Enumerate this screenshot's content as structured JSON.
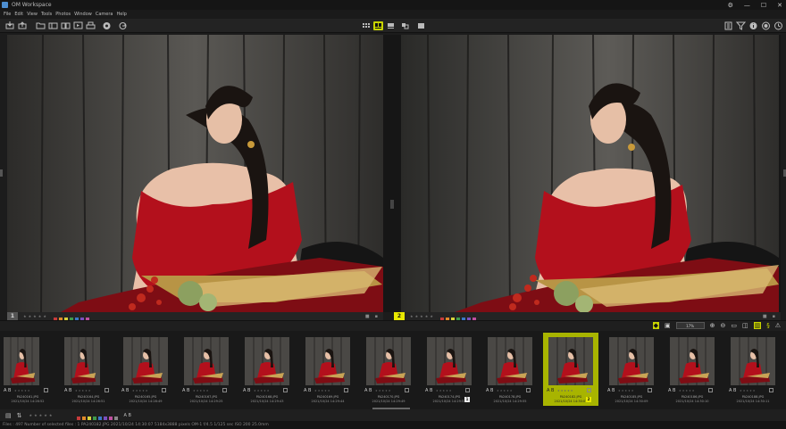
{
  "app": {
    "title": "OM Workspace"
  },
  "window_controls": [
    "⚙",
    "—",
    "☐",
    "✕"
  ],
  "menu": [
    "File",
    "Edit",
    "View",
    "Tools",
    "Photos",
    "Window",
    "Camera",
    "Help"
  ],
  "toolbar_left_icons": [
    "import-icon",
    "export-icon",
    "folder-icon",
    "layout-icon",
    "compare-icon",
    "slideshow-icon",
    "print-icon",
    "share-icon",
    "camera-icon",
    "record-icon",
    "sync-icon"
  ],
  "toolbar_center_icons": [
    "grid-view-icon",
    "compare-view-icon",
    "list-view-icon",
    "single-view-icon"
  ],
  "toolbar_right_icons": [
    "panel-icon",
    "filter-icon",
    "info-icon",
    "raw-icon",
    "history-icon"
  ],
  "panes": [
    {
      "number": "1",
      "active": false
    },
    {
      "number": "2",
      "active": true
    }
  ],
  "rating_stars": "★★★★★",
  "color_labels": [
    "#c63b3b",
    "#e08a2a",
    "#d8d23b",
    "#3f9a4a",
    "#3a78c8",
    "#7b4fc0",
    "#c050a0",
    "#888888"
  ],
  "zoom": {
    "value": "17%"
  },
  "thumbnails": [
    {
      "ab": "A B",
      "name": "PA240161.JPG",
      "date": "2021/10/24 14:26:52",
      "selected": false,
      "portrait": true,
      "badge": ""
    },
    {
      "ab": "A B",
      "name": "PA240164.JPG",
      "date": "2021/10/24 14:26:51",
      "selected": false,
      "portrait": true,
      "badge": ""
    },
    {
      "ab": "A B",
      "name": "PA240165.JPG",
      "date": "2021/10/24 14:28:49",
      "selected": false,
      "portrait": false,
      "badge": ""
    },
    {
      "ab": "A B",
      "name": "PA240167.JPG",
      "date": "2021/10/24 14:29:25",
      "selected": false,
      "portrait": false,
      "badge": ""
    },
    {
      "ab": "A B",
      "name": "PA240168.JPG",
      "date": "2021/10/24 14:29:43",
      "selected": false,
      "portrait": false,
      "badge": ""
    },
    {
      "ab": "A B",
      "name": "PA240169.JPG",
      "date": "2021/10/24 14:29:44",
      "selected": false,
      "portrait": false,
      "badge": ""
    },
    {
      "ab": "A B",
      "name": "PA240170.JPG",
      "date": "2021/10/24 14:29:49",
      "selected": false,
      "portrait": false,
      "badge": ""
    },
    {
      "ab": "A B",
      "name": "PA240174.JPG",
      "date": "2021/10/24 14:29:53",
      "selected": false,
      "portrait": false,
      "badge": "1"
    },
    {
      "ab": "A B",
      "name": "PA240178.JPG",
      "date": "2021/10/24 14:29:55",
      "selected": false,
      "portrait": false,
      "badge": ""
    },
    {
      "ab": "A B",
      "name": "PA240182.JPG",
      "date": "2021/10/24 14:30:07",
      "selected": true,
      "portrait": false,
      "badge": "2"
    },
    {
      "ab": "A B",
      "name": "PA240185.JPG",
      "date": "2021/10/24 14:30:09",
      "selected": false,
      "portrait": false,
      "badge": ""
    },
    {
      "ab": "A B",
      "name": "PA240186.JPG",
      "date": "2021/10/24 14:30:10",
      "selected": false,
      "portrait": false,
      "badge": ""
    },
    {
      "ab": "A B",
      "name": "PA240188.JPG",
      "date": "2021/10/24 14:30:11",
      "selected": false,
      "portrait": false,
      "badge": ""
    }
  ],
  "status": "Files : 497  Number of selected files : 1  PA240182.JPG  2021/10/24 14:30:07  5184x3888 pixels  OM-1  f/4.5  1/125 sec  ISO 200  25.0mm"
}
